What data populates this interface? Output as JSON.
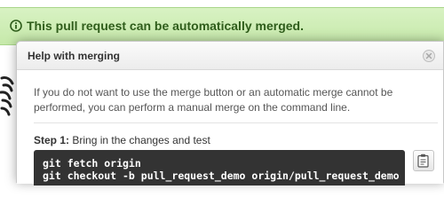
{
  "banner": {
    "text": "This pull request can be automatically merged.",
    "icon": "info-icon",
    "color": "#c6e9aa"
  },
  "modal": {
    "title": "Help with merging",
    "close_icon": "close-icon",
    "intro": "If you do not want to use the merge button or an automatic merge cannot be performed, you can perform a manual merge on the command line.",
    "step": {
      "label": "Step 1:",
      "text": "Bring in the changes and test"
    },
    "code_lines": [
      "git fetch origin",
      "git checkout -b pull_request_demo origin/pull_request_demo"
    ],
    "copy_icon": "clipboard-icon"
  }
}
